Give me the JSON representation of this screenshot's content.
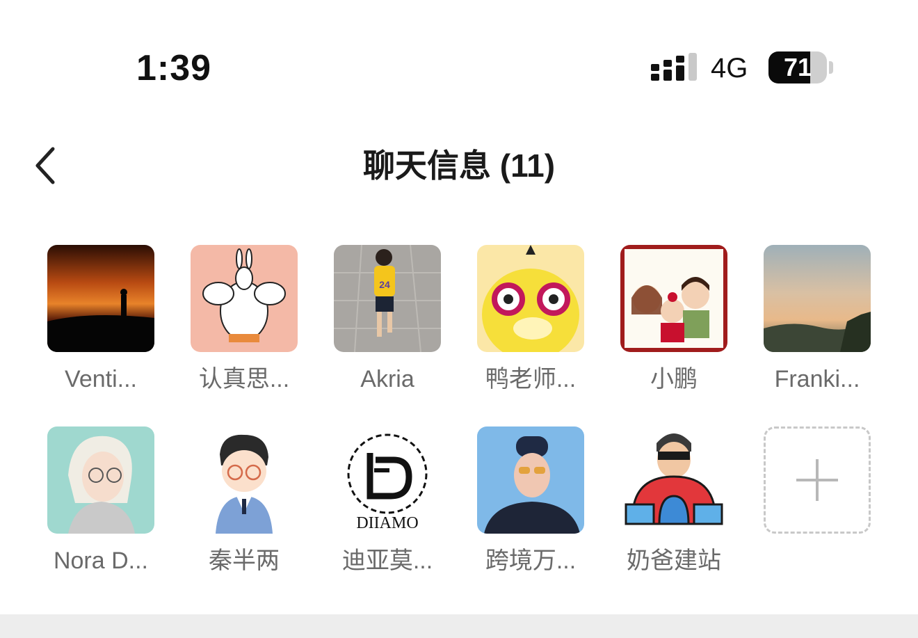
{
  "status_bar": {
    "time": "1:39",
    "network": "4G",
    "battery_level": "71",
    "battery_fraction": 0.71
  },
  "header": {
    "title": "聊天信息 (11)",
    "back_icon": "chevron-left-icon"
  },
  "members": [
    {
      "name": "Venti..."
    },
    {
      "name": "认真思..."
    },
    {
      "name": "Akria"
    },
    {
      "name": "鸭老师..."
    },
    {
      "name": "小鹏"
    },
    {
      "name": "Franki..."
    },
    {
      "name": "Nora D..."
    },
    {
      "name": "秦半两"
    },
    {
      "name": "迪亚莫..."
    },
    {
      "name": "跨境万..."
    },
    {
      "name": "奶爸建站"
    }
  ],
  "avatar_texts": {
    "diiamo_logo": "DIIAMO",
    "jersey_number": "24"
  },
  "add_member_icon": "plus-icon"
}
